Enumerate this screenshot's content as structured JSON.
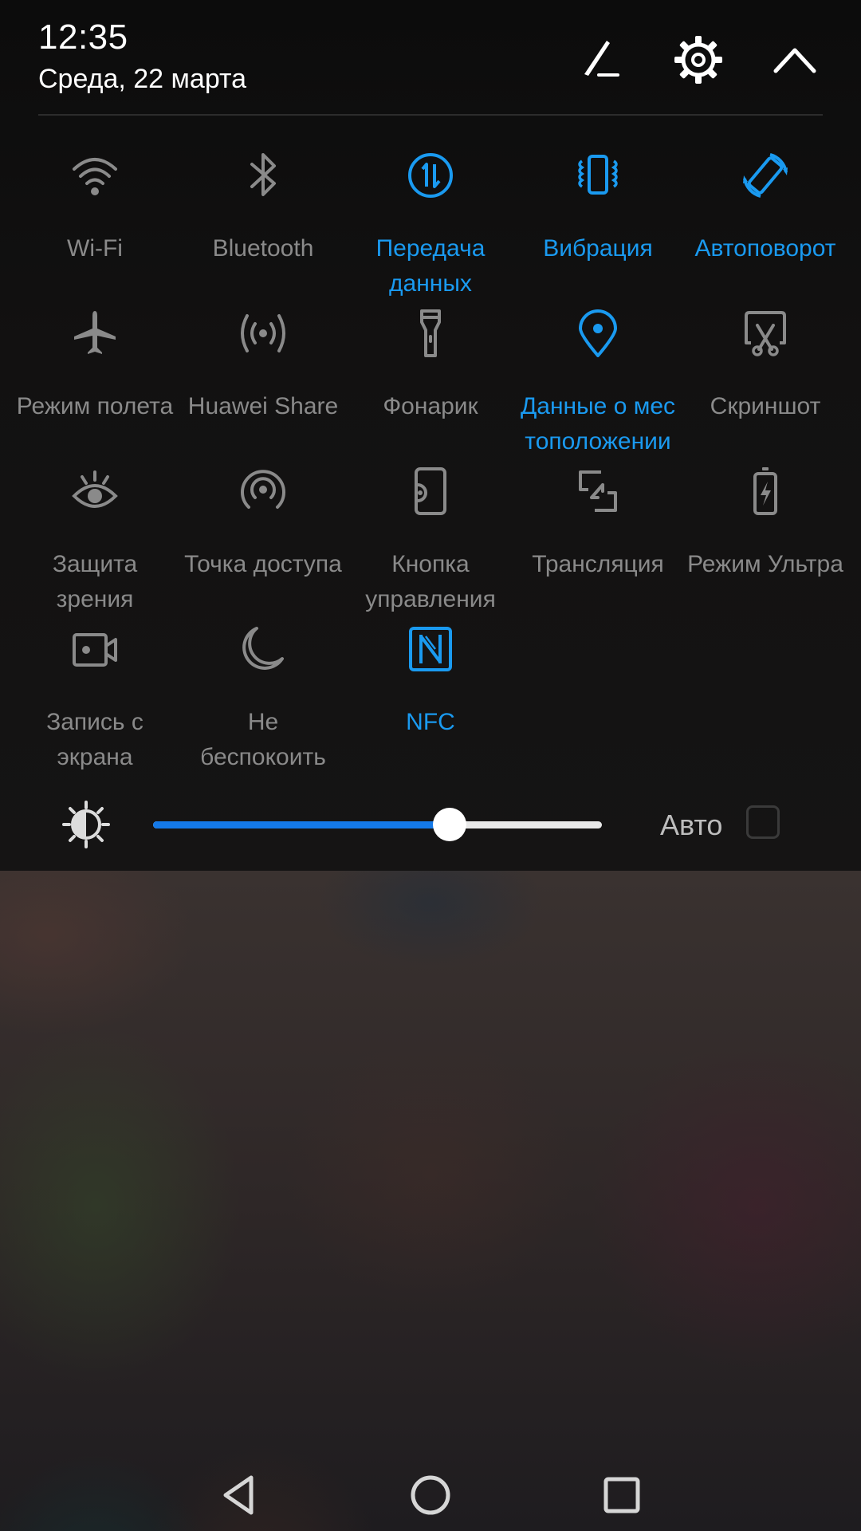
{
  "header": {
    "time": "12:35",
    "date": "Среда, 22 марта",
    "buttons": [
      "edit-icon",
      "gear-icon",
      "chevron-up-icon"
    ]
  },
  "tiles": [
    {
      "label": "Wi-Fi",
      "icon": "wifi-icon",
      "active": false
    },
    {
      "label": "Bluetooth",
      "icon": "bluetooth-icon",
      "active": false
    },
    {
      "label": "Передача данных",
      "icon": "mobile-data-icon",
      "active": true
    },
    {
      "label": "Вибрация",
      "icon": "vibration-icon",
      "active": true
    },
    {
      "label": "Автоповорот",
      "icon": "auto-rotate-icon",
      "active": true
    },
    {
      "label": "Режим полета",
      "icon": "airplane-icon",
      "active": false
    },
    {
      "label": "Huawei Share",
      "icon": "huawei-share-icon",
      "active": false
    },
    {
      "label": "Фонарик",
      "icon": "flashlight-icon",
      "active": false
    },
    {
      "label": "Данные о местоположении",
      "icon": "location-icon",
      "active": true
    },
    {
      "label": "Скриншот",
      "icon": "screenshot-icon",
      "active": false
    },
    {
      "label": "Защита зрения",
      "icon": "eye-comfort-icon",
      "active": false
    },
    {
      "label": "Точка доступа",
      "icon": "hotspot-icon",
      "active": false
    },
    {
      "label": "Кнопка управления",
      "icon": "navigation-dock-icon",
      "active": false
    },
    {
      "label": "Трансляция",
      "icon": "cast-icon",
      "active": false
    },
    {
      "label": "Режим Ультра",
      "icon": "ultra-battery-icon",
      "active": false
    },
    {
      "label": "Запись с экрана",
      "icon": "screen-record-icon",
      "active": false
    },
    {
      "label": "Не беспокоить",
      "icon": "moon-icon",
      "active": false
    },
    {
      "label": "NFC",
      "icon": "nfc-icon",
      "active": true
    }
  ],
  "tile_labels_wrapped": [
    [
      "Wi-Fi"
    ],
    [
      "Bluetooth"
    ],
    [
      "Передача",
      "данных"
    ],
    [
      "Вибрация"
    ],
    [
      "Автоповорот"
    ],
    [
      "Режим полета"
    ],
    [
      "Huawei Share"
    ],
    [
      "Фонарик"
    ],
    [
      "Данные о мес",
      "тоположении"
    ],
    [
      "Скриншот"
    ],
    [
      "Защита",
      "зрения"
    ],
    [
      "Точка доступа"
    ],
    [
      "Кнопка",
      "управления"
    ],
    [
      "Трансляция"
    ],
    [
      "Режим Ультра"
    ],
    [
      "Запись с",
      "экрана"
    ],
    [
      "Не",
      "беспокоить"
    ],
    [
      "NFC"
    ]
  ],
  "brightness": {
    "level_percent": 66,
    "auto_label": "Авто",
    "auto_checked": false
  },
  "colors": {
    "accent": "#1a9af0",
    "inactive": "#8a8a8a",
    "slider_fill": "#1479e8"
  },
  "nav": [
    "back-icon",
    "home-icon",
    "recents-icon"
  ]
}
